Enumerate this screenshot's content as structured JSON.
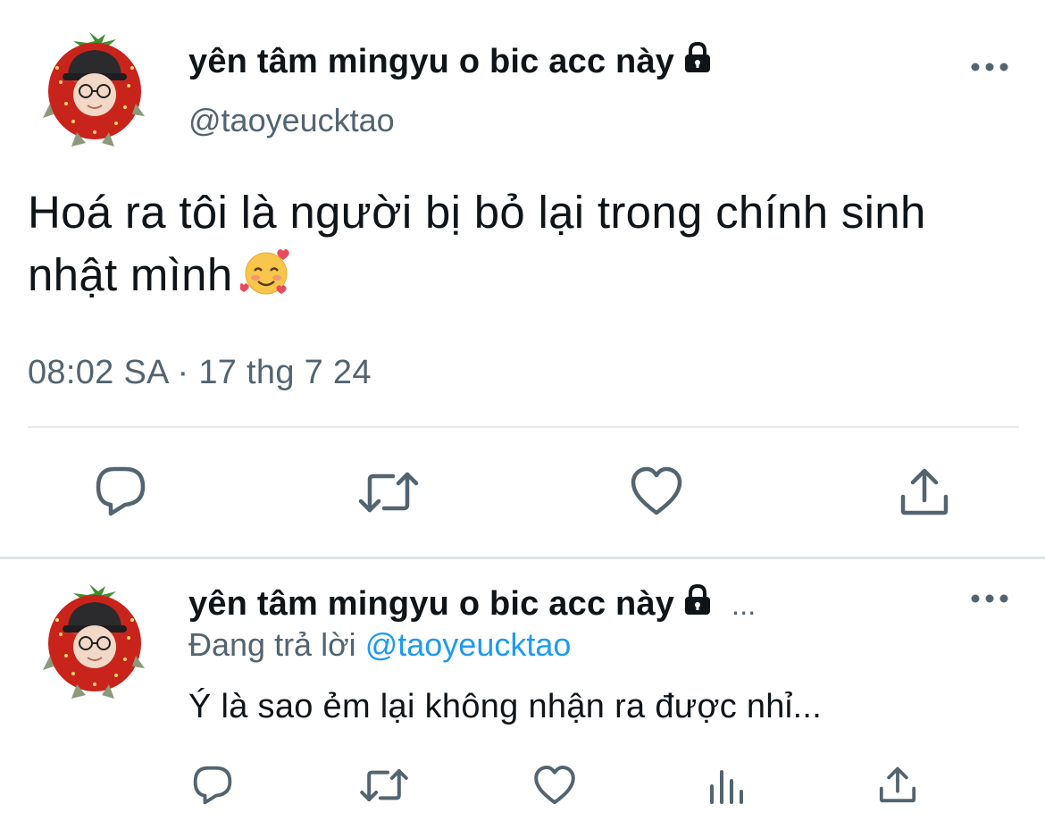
{
  "tweet": {
    "author": {
      "display_name": "yên tâm mingyu o bic acc này",
      "handle": "@taoyeucktao",
      "avatar": "strawberry-avatar",
      "protected_icon": "lock-icon"
    },
    "text_line1": "Hoá ra tôi là người bị bỏ lại trong chính sinh",
    "text_line2": "nhật mình",
    "emoji": "smiling-face-with-hearts",
    "timestamp": "08:02 SA · 17 thg 7 24",
    "actions": [
      "reply-icon",
      "retweet-icon",
      "like-icon",
      "share-icon"
    ]
  },
  "reply": {
    "author": {
      "display_name": "yên tâm mingyu o bic acc này",
      "truncation": "...",
      "avatar": "strawberry-avatar",
      "protected_icon": "lock-icon"
    },
    "replying_prefix": "Đang trả lời",
    "replying_to": "@taoyeucktao",
    "text": "Ý là sao ẻm lại không nhận ra được nhỉ...",
    "actions": [
      "reply-icon",
      "retweet-icon",
      "like-icon",
      "views-icon",
      "share-icon"
    ]
  },
  "colors": {
    "text_primary": "#0f1419",
    "text_secondary": "#536471",
    "link": "#1d9bf0",
    "divider": "#e7e9ea"
  }
}
